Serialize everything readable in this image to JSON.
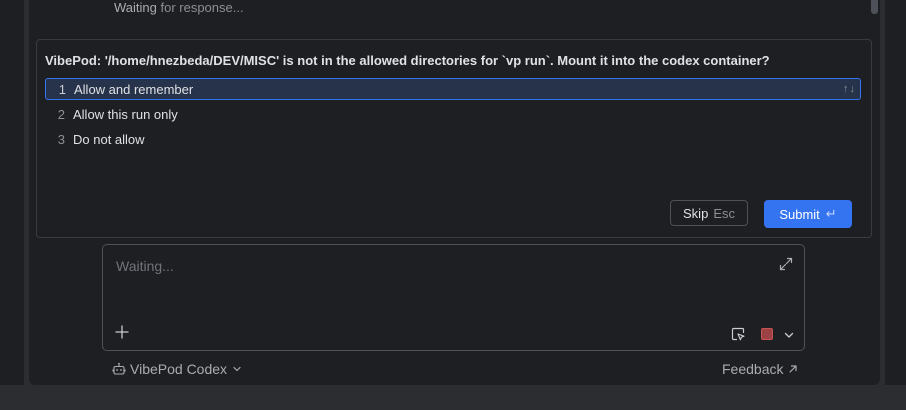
{
  "log": {
    "waiting_word": "Waiting",
    "waiting_rest": " for response..."
  },
  "question": {
    "text": "VibePod: '/home/hnezbeda/DEV/MISC' is not in the allowed directories for `vp run`. Mount it into the codex container?",
    "options": [
      {
        "num": "1",
        "label": "Allow and remember"
      },
      {
        "num": "2",
        "label": "Allow this run only"
      },
      {
        "num": "3",
        "label": "Do not allow"
      }
    ],
    "selected_arrows": "↑↓",
    "skip_label": "Skip",
    "skip_hint": "Esc",
    "submit_label": "Submit",
    "submit_hint": "↵"
  },
  "input": {
    "placeholder": "Waiting..."
  },
  "footer": {
    "agent_label": "VibePod Codex",
    "feedback_label": "Feedback"
  },
  "colors": {
    "accent": "#3574f0",
    "stop": "#c75450"
  }
}
